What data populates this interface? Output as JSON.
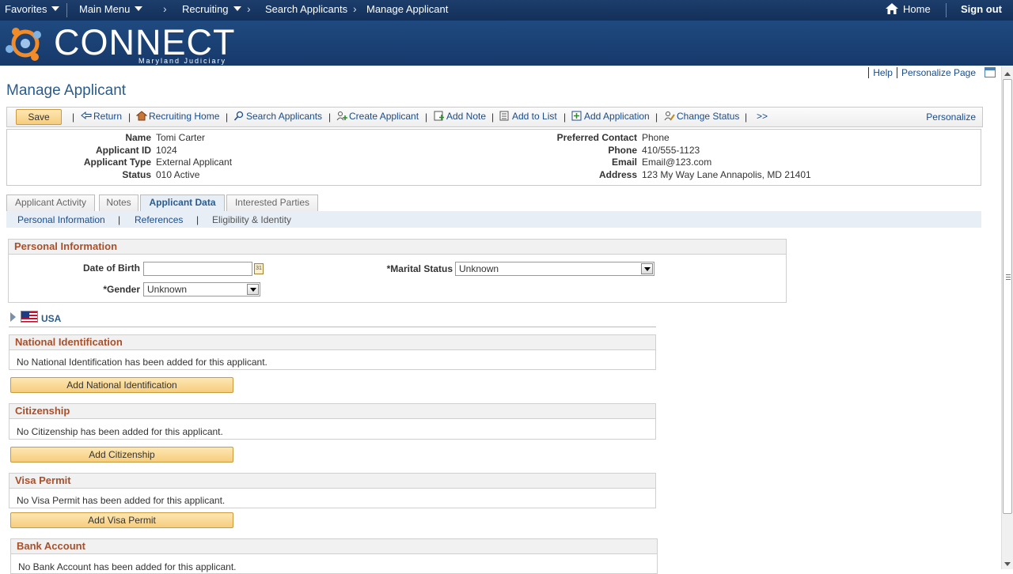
{
  "topnav": {
    "favorites": "Favorites",
    "main_menu": "Main Menu",
    "recruiting": "Recruiting",
    "search_applicants": "Search Applicants",
    "manage_applicant": "Manage Applicant",
    "home": "Home",
    "sign_out": "Sign out"
  },
  "banner": {
    "logo": "CONNECT",
    "logo_sub": "Maryland Judiciary"
  },
  "help_links": {
    "help": "Help",
    "personalize_page": "Personalize Page"
  },
  "page_title": "Manage Applicant",
  "toolbar": {
    "save": "Save",
    "return": "Return",
    "recruiting_home": "Recruiting Home",
    "search_applicants": "Search Applicants",
    "create_applicant": "Create Applicant",
    "add_note": "Add Note",
    "add_to_list": "Add to List",
    "add_application": "Add Application",
    "change_status": "Change Status",
    "more": ">>",
    "personalize": "Personalize"
  },
  "summary": {
    "name_label": "Name",
    "name": "Tomi Carter",
    "id_label": "Applicant ID",
    "id": "1024",
    "type_label": "Applicant Type",
    "type": "External Applicant",
    "status_label": "Status",
    "status": "010 Active",
    "contact_label": "Preferred Contact",
    "contact": "Phone",
    "phone_label": "Phone",
    "phone": "410/555-1123",
    "email_label": "Email",
    "email": "Email@123.com",
    "address_label": "Address",
    "address": "123 My Way Lane Annapolis, MD 21401"
  },
  "tabs": [
    "Applicant Activity",
    "Notes",
    "Applicant Data",
    "Interested Parties"
  ],
  "subtabs": {
    "personal": "Personal Information",
    "references": "References",
    "eligibility": "Eligibility & Identity",
    "sep": "|"
  },
  "personal_info": {
    "title": "Personal Information",
    "dob_label": "Date of Birth",
    "dob_value": "",
    "calendar_icon_text": "31",
    "gender_label": "*Gender",
    "gender_value": "Unknown",
    "marital_label": "*Marital Status",
    "marital_value": "Unknown"
  },
  "country": {
    "label": "USA"
  },
  "national_id": {
    "title": "National Identification",
    "message": "No National Identification has been added for this applicant.",
    "button": "Add National Identification"
  },
  "citizenship": {
    "title": "Citizenship",
    "message": "No Citizenship has been added for this applicant.",
    "button": "Add Citizenship"
  },
  "visa": {
    "title": "Visa Permit",
    "message": "No Visa Permit has been added for this applicant.",
    "button": "Add Visa Permit"
  },
  "bank": {
    "title": "Bank Account",
    "message": "No Bank Account has been added for this applicant."
  },
  "colors": {
    "nav": "#13305a",
    "accent": "#2b5c8c",
    "section_title": "#a9502b",
    "button": "#f6cd7e"
  }
}
